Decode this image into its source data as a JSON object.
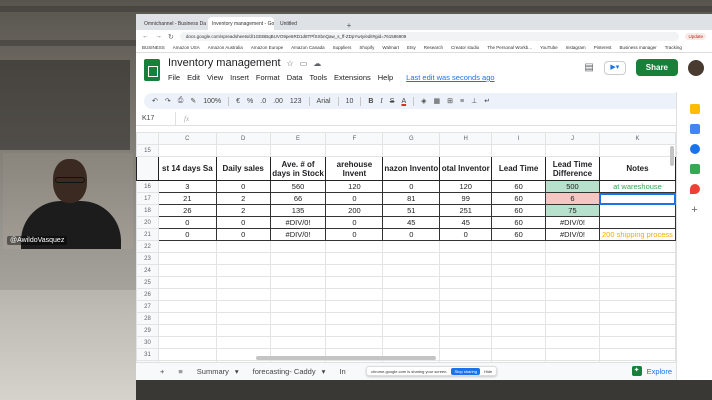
{
  "browser": {
    "tabs": [
      "Omnichannel - Business Dashboard",
      "Inventory management - Google Sheets",
      "Untitled"
    ],
    "tab_add": "+",
    "url": "docs.google.com/spreadsheets/d/1GEBBqBUVO9pe6RD1d8TPfSXbnQaw_s_ff-ZDpYwIy/edit#gid=761586909",
    "update_label": "Update",
    "bookmarks": [
      "BUSINESS",
      "Amazon USA",
      "Amazon Australia",
      "Amazon Europe",
      "Amazon Canada",
      "Suppliers",
      "Shopify",
      "Walmart",
      "Etsy",
      "Research",
      "Creator studio",
      "The Personal Workb...",
      "YouTube",
      "Instagram",
      "Pinterest",
      "Business manager",
      "Tracking"
    ]
  },
  "sheets": {
    "title": "Inventory management",
    "menu": [
      "File",
      "Edit",
      "View",
      "Insert",
      "Format",
      "Data",
      "Tools",
      "Extensions",
      "Help"
    ],
    "last_edit": "Last edit was seconds ago",
    "share_label": "Share",
    "toolbar": {
      "zoom": "100%",
      "currency": "€",
      "percent": "%",
      "decimal_dec": ".0",
      "decimal_inc": ".00",
      "number_format": "123",
      "font": "Arial",
      "font_size": "10",
      "bold": "B",
      "italic": "I",
      "strike": "S",
      "text_color": "A"
    },
    "namebox": "K17",
    "fx": "fx",
    "columns": [
      "C",
      "D",
      "E",
      "F",
      "G",
      "H",
      "I",
      "J",
      "K"
    ],
    "rows": [
      {
        "num": "15",
        "cells": [
          "",
          "",
          "",
          "",
          "",
          "",
          "",
          "",
          ""
        ]
      },
      {
        "num": "16",
        "cells": [
          "3",
          "0",
          "560",
          "120",
          "0",
          "120",
          "60",
          "500",
          "at wareshouse"
        ],
        "styles": [
          "",
          "",
          "",
          "",
          "",
          "",
          "",
          "green",
          "note-green"
        ]
      },
      {
        "num": "17",
        "cells": [
          "21",
          "2",
          "66",
          "0",
          "81",
          "99",
          "60",
          "6",
          ""
        ],
        "styles": [
          "",
          "",
          "",
          "",
          "",
          "",
          "",
          "red",
          "selected"
        ]
      },
      {
        "num": "18",
        "cells": [
          "26",
          "2",
          "135",
          "200",
          "51",
          "251",
          "60",
          "75",
          ""
        ],
        "styles": [
          "",
          "",
          "",
          "",
          "",
          "",
          "",
          "green",
          ""
        ]
      },
      {
        "num": "20",
        "cells": [
          "0",
          "0",
          "#DIV/0!",
          "0",
          "45",
          "45",
          "60",
          "#DIV/0!",
          ""
        ]
      },
      {
        "num": "21",
        "cells": [
          "0",
          "0",
          "#DIV/0!",
          "0",
          "0",
          "0",
          "60",
          "#DIV/0!",
          "200 shipping process"
        ],
        "styles": [
          "",
          "",
          "",
          "",
          "",
          "",
          "",
          "",
          "note-orange"
        ]
      },
      {
        "num": "22",
        "cells": []
      },
      {
        "num": "23",
        "cells": []
      },
      {
        "num": "24",
        "cells": []
      },
      {
        "num": "25",
        "cells": []
      },
      {
        "num": "26",
        "cells": []
      },
      {
        "num": "27",
        "cells": []
      },
      {
        "num": "28",
        "cells": []
      },
      {
        "num": "29",
        "cells": []
      },
      {
        "num": "30",
        "cells": []
      },
      {
        "num": "31",
        "cells": []
      },
      {
        "num": "32",
        "cells": []
      }
    ],
    "header_row_num": "",
    "headers": [
      "st 14 days Sa",
      "Daily sales",
      "Ave. # of days in Stock",
      "arehouse Invent",
      "nazon Invento",
      "otal Inventor",
      "Lead Time",
      "Lead Time Difference",
      "Notes"
    ],
    "sheet_tabs": [
      "Summary",
      "forecasting- Caddy",
      "In"
    ],
    "sheet_tab_trailing": "recast",
    "explore_label": "Explore",
    "share_banner": "chrome.google.com is sharing your screen.",
    "stop_label": "Stop sharing",
    "hide_label": "Hide"
  },
  "webcam": {
    "name": "@AwildoVasquez"
  }
}
